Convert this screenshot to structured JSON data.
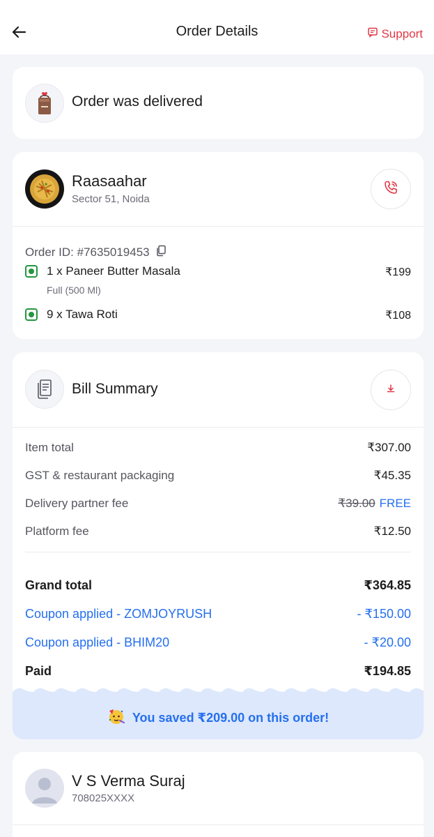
{
  "header": {
    "title": "Order Details",
    "support_label": "Support"
  },
  "status": {
    "text": "Order was delivered"
  },
  "restaurant": {
    "name": "Raasaahar",
    "location": "Sector 51, Noida"
  },
  "order": {
    "id_label": "Order ID: #7635019453",
    "items": [
      {
        "name": "1 x Paneer Butter Masala",
        "variant": "Full (500 Ml)",
        "price": "₹199"
      },
      {
        "name": "9 x Tawa Roti",
        "variant": "",
        "price": "₹108"
      }
    ]
  },
  "bill": {
    "title": "Bill Summary",
    "rows": [
      {
        "label": "Item total",
        "value": "₹307.00"
      },
      {
        "label": "GST & restaurant packaging",
        "value": "₹45.35"
      },
      {
        "label": "Delivery partner fee",
        "old_value": "₹39.00",
        "value": "FREE"
      },
      {
        "label": "Platform fee",
        "value": "₹12.50"
      }
    ],
    "grand_total": {
      "label": "Grand total",
      "value": "₹364.85"
    },
    "coupons": [
      {
        "label": "Coupon applied - ZOMJOYRUSH",
        "value": "- ₹150.00"
      },
      {
        "label": "Coupon applied - BHIM20",
        "value": "- ₹20.00"
      }
    ],
    "paid": {
      "label": "Paid",
      "value": "₹194.85"
    },
    "savings_text": "You saved ₹209.00 on this order!"
  },
  "customer": {
    "name": "V S Verma Suraj",
    "phone": "708025XXXX"
  },
  "colors": {
    "accent_red": "#e23744",
    "accent_blue": "#256fef",
    "veg_green": "#24963f"
  }
}
